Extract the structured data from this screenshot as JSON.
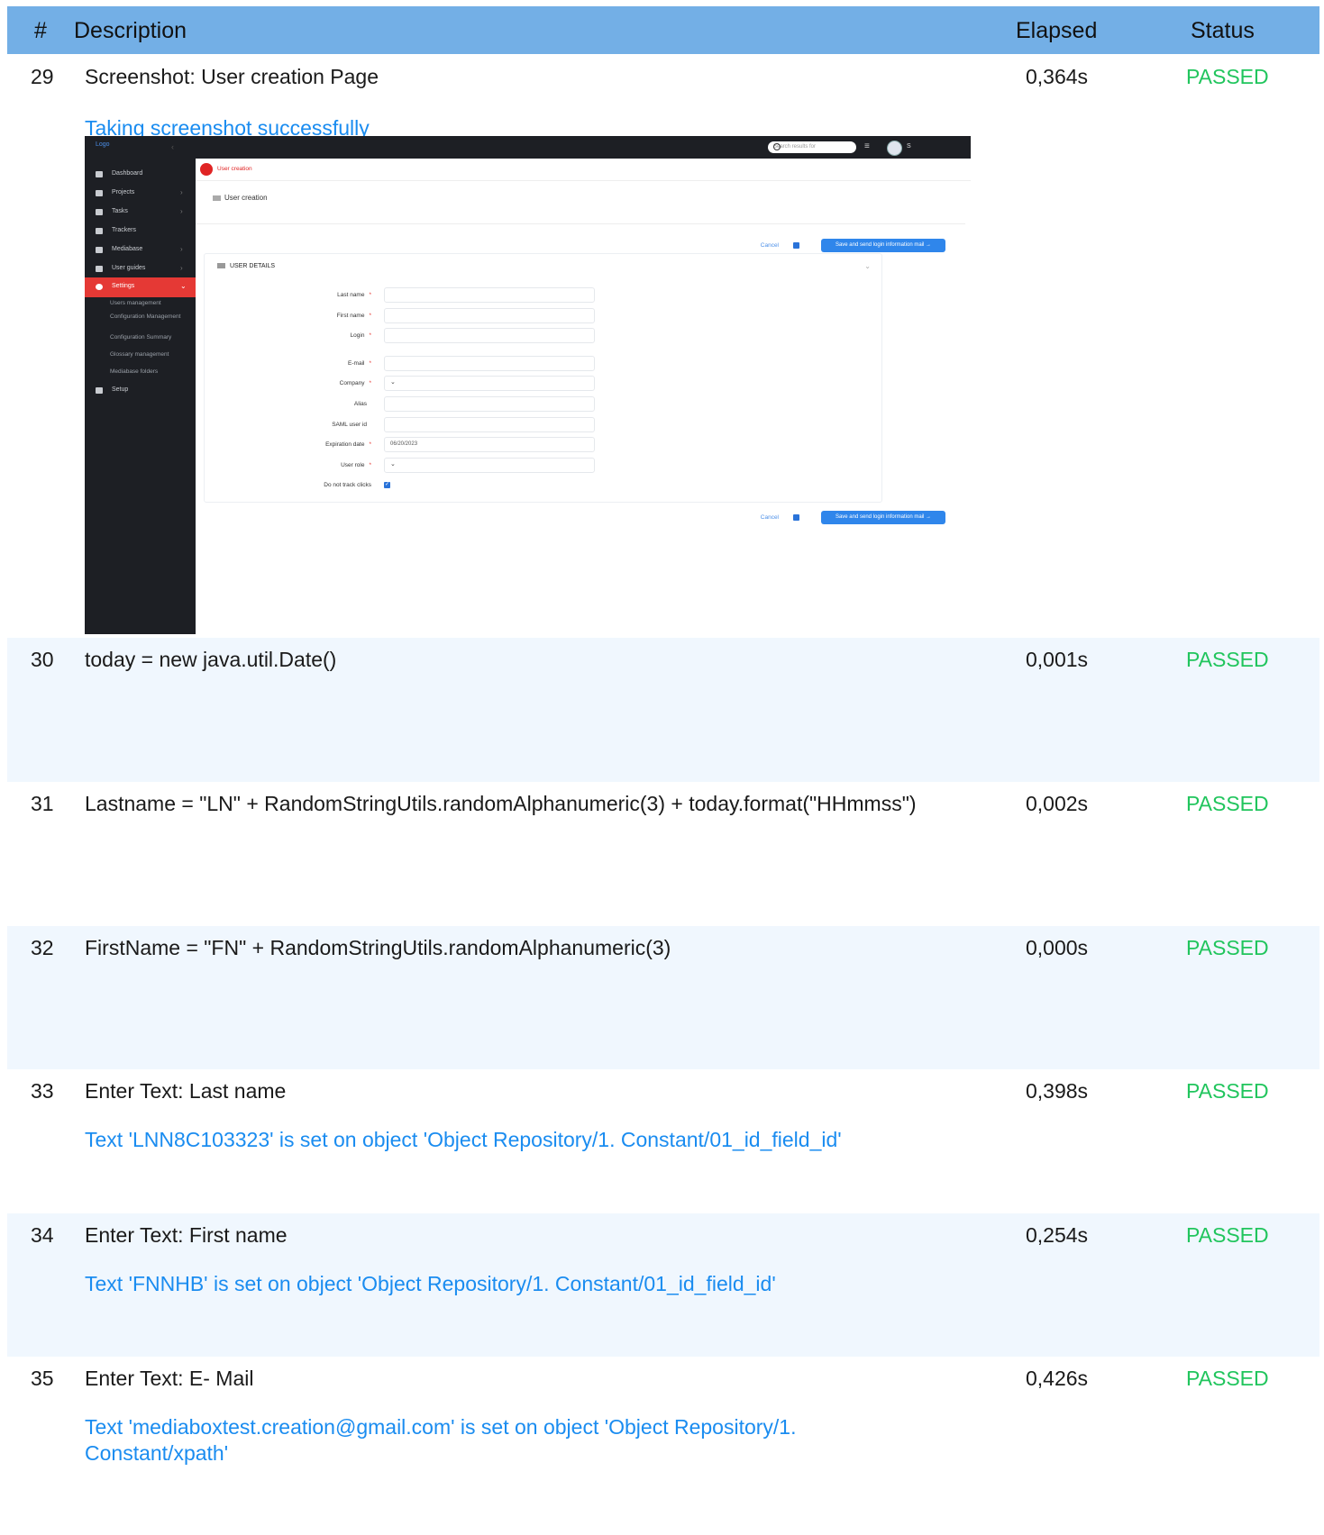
{
  "header": {
    "num": "#",
    "description": "Description",
    "elapsed": "Elapsed",
    "status": "Status"
  },
  "rows": [
    {
      "num": "29",
      "description": "Screenshot: User creation Page",
      "elapsed": "0,364s",
      "status": "PASSED",
      "message": "Taking screenshot successfully"
    },
    {
      "num": "30",
      "description": "today = new java.util.Date()",
      "elapsed": "0,001s",
      "status": "PASSED"
    },
    {
      "num": "31",
      "description": "Lastname = \"LN\" + RandomStringUtils.randomAlphanumeric(3) + today.format(\"HHmmss\")",
      "elapsed": "0,002s",
      "status": "PASSED"
    },
    {
      "num": "32",
      "description": "FirstName = \"FN\" + RandomStringUtils.randomAlphanumeric(3)",
      "elapsed": "0,000s",
      "status": "PASSED"
    },
    {
      "num": "33",
      "description": "Enter Text: Last name",
      "elapsed": "0,398s",
      "status": "PASSED",
      "message": "Text 'LNN8C103323' is set on object 'Object Repository/1. Constant/01_id_field_id'"
    },
    {
      "num": "34",
      "description": "Enter Text: First name",
      "elapsed": "0,254s",
      "status": "PASSED",
      "message": "Text 'FNNHB' is set on object 'Object Repository/1. Constant/01_id_field_id'"
    },
    {
      "num": "35",
      "description": "Enter Text: E- Mail",
      "elapsed": "0,426s",
      "status": "PASSED",
      "message": "Text 'mediaboxtest.creation@gmail.com' is set on object 'Object Repository/1. Constant/xpath'"
    }
  ],
  "screenshot": {
    "logo": "Logo",
    "sidebar": [
      "Dashboard",
      "Projects",
      "Tasks",
      "Trackers",
      "Mediabase",
      "User guides",
      "Settings"
    ],
    "submenu": [
      "Users management",
      "Configuration Management",
      "Configuration Summary",
      "Glossary management",
      "Mediabase folders"
    ],
    "setup": "Setup",
    "search_placeholder": "Search results for",
    "avatar_label": "S",
    "tab": "User creation",
    "breadcrumb": "User creation",
    "cancel": "Cancel",
    "send": "Save and send login information mail →",
    "card_title": "USER DETAILS",
    "fields": [
      {
        "label": "Last name",
        "required": "*",
        "value": ""
      },
      {
        "label": "First name",
        "required": "*",
        "value": ""
      },
      {
        "label": "Login",
        "required": "*",
        "value": ""
      },
      {
        "label": "E-mail",
        "required": "*",
        "value": ""
      },
      {
        "label": "Company",
        "required": "*",
        "value": ""
      },
      {
        "label": "Alias",
        "required": "",
        "value": ""
      },
      {
        "label": "SAML user id",
        "required": "",
        "value": ""
      },
      {
        "label": "Expiration date",
        "required": "*",
        "value": "06/20/2023"
      },
      {
        "label": "User role",
        "required": "*",
        "value": ""
      },
      {
        "label": "Do not track clicks",
        "required": "",
        "value": ""
      }
    ],
    "checkbox_mark": "✓"
  }
}
